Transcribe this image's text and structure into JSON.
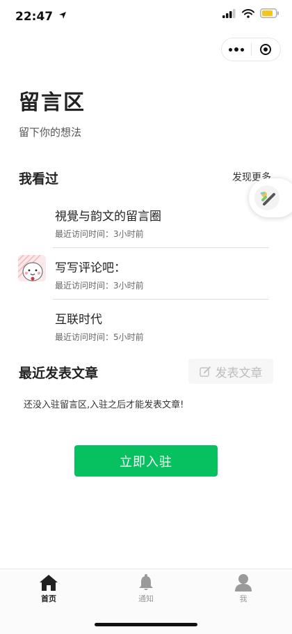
{
  "status_bar": {
    "time": "22:47"
  },
  "page": {
    "title": "留言区",
    "subtitle": "留下你的想法"
  },
  "viewed": {
    "heading": "我看过",
    "more_label": "发现更多",
    "items": [
      {
        "title": "視覺与韵文的留言圈",
        "subtitle": "最近访问时间：3小时前"
      },
      {
        "title": "写写评论吧：",
        "subtitle": "最近访问时间：3小时前"
      },
      {
        "title": "互联时代",
        "subtitle": "最近访问时间：5小时前"
      }
    ]
  },
  "recent": {
    "heading": "最近发表文章",
    "publish_label": "发表文章",
    "notice": "还没入驻留言区,入驻之后才能发表文章!",
    "join_label": "立即入驻"
  },
  "tabbar": {
    "items": [
      {
        "label": "首页",
        "icon": "home-icon",
        "active": true
      },
      {
        "label": "通知",
        "icon": "bell-icon",
        "active": false
      },
      {
        "label": "我",
        "icon": "user-icon",
        "active": false
      }
    ]
  },
  "colors": {
    "accent": "#07c160",
    "inactive_tab": "#9a9a9a",
    "active_tab": "#222222"
  }
}
